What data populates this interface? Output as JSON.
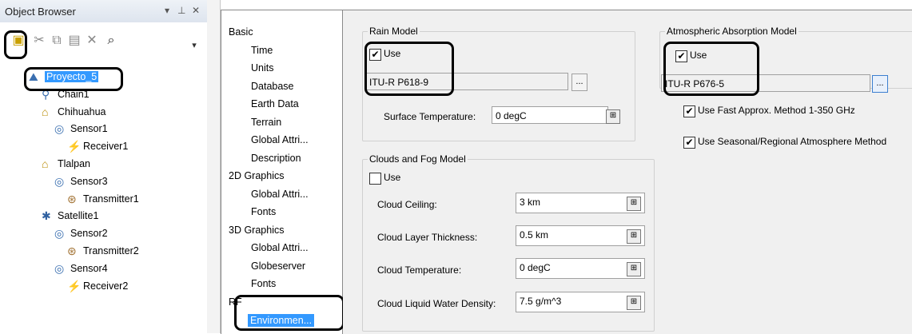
{
  "object_browser": {
    "title": "Object Browser",
    "title_controls": [
      "▾",
      "ᵖ",
      "✕"
    ],
    "tree": [
      {
        "label": "Proyecto_5",
        "level": 0,
        "icon": "scenario-icon",
        "selected": true
      },
      {
        "label": "Chain1",
        "level": 1,
        "icon": "chain-icon"
      },
      {
        "label": "Chihuahua",
        "level": 1,
        "icon": "facility-icon"
      },
      {
        "label": "Sensor1",
        "level": 2,
        "icon": "sensor-icon"
      },
      {
        "label": "Receiver1",
        "level": 3,
        "icon": "receiver-icon"
      },
      {
        "label": "Tlalpan",
        "level": 1,
        "icon": "facility-icon"
      },
      {
        "label": "Sensor3",
        "level": 2,
        "icon": "sensor-icon"
      },
      {
        "label": "Transmitter1",
        "level": 3,
        "icon": "transmitter-icon"
      },
      {
        "label": "Satellite1",
        "level": 1,
        "icon": "satellite-icon"
      },
      {
        "label": "Sensor2",
        "level": 2,
        "icon": "sensor-icon"
      },
      {
        "label": "Transmitter2",
        "level": 3,
        "icon": "transmitter-icon"
      },
      {
        "label": "Sensor4",
        "level": 2,
        "icon": "sensor-icon"
      },
      {
        "label": "Receiver2",
        "level": 3,
        "icon": "receiver-icon"
      }
    ]
  },
  "categories": [
    {
      "label": "Basic",
      "indent": 0
    },
    {
      "label": "Time",
      "indent": 1
    },
    {
      "label": "Units",
      "indent": 1
    },
    {
      "label": "Database",
      "indent": 1
    },
    {
      "label": "Earth Data",
      "indent": 1
    },
    {
      "label": "Terrain",
      "indent": 1
    },
    {
      "label": "Global Attri...",
      "indent": 1
    },
    {
      "label": "Description",
      "indent": 1
    },
    {
      "label": "2D Graphics",
      "indent": 0
    },
    {
      "label": "Global Attri...",
      "indent": 1
    },
    {
      "label": "Fonts",
      "indent": 1
    },
    {
      "label": "3D Graphics",
      "indent": 0
    },
    {
      "label": "Global Attri...",
      "indent": 1
    },
    {
      "label": "Globeserver",
      "indent": 1
    },
    {
      "label": "Fonts",
      "indent": 1
    },
    {
      "label": "RF",
      "indent": 0
    },
    {
      "label": "Environmen...",
      "indent": 1,
      "selected": true
    }
  ],
  "rain": {
    "title": "Rain Model",
    "use_label": "Use",
    "use_checked": true,
    "model": "ITU-R P618-9",
    "dots": "...",
    "surface_temp_label": "Surface Temperature:",
    "surface_temp": "0 degC"
  },
  "clouds": {
    "title": "Clouds and Fog Model",
    "use_label": "Use",
    "use_checked": false,
    "fields": [
      {
        "label": "Cloud Ceiling:",
        "value": "3 km"
      },
      {
        "label": "Cloud Layer Thickness:",
        "value": "0.5 km"
      },
      {
        "label": "Cloud Temperature:",
        "value": "0 degC"
      },
      {
        "label": "Cloud Liquid Water Density:",
        "value": "7.5 g/m^3"
      }
    ]
  },
  "atmos": {
    "title": "Atmospheric Absorption Model",
    "use_label": "Use",
    "use_checked": true,
    "model": "ITU-R P676-5",
    "dots": "...",
    "fast_label": "Use Fast Approx. Method 1-350 GHz",
    "seasonal_label": "Use Seasonal/Regional Atmosphere Method"
  }
}
